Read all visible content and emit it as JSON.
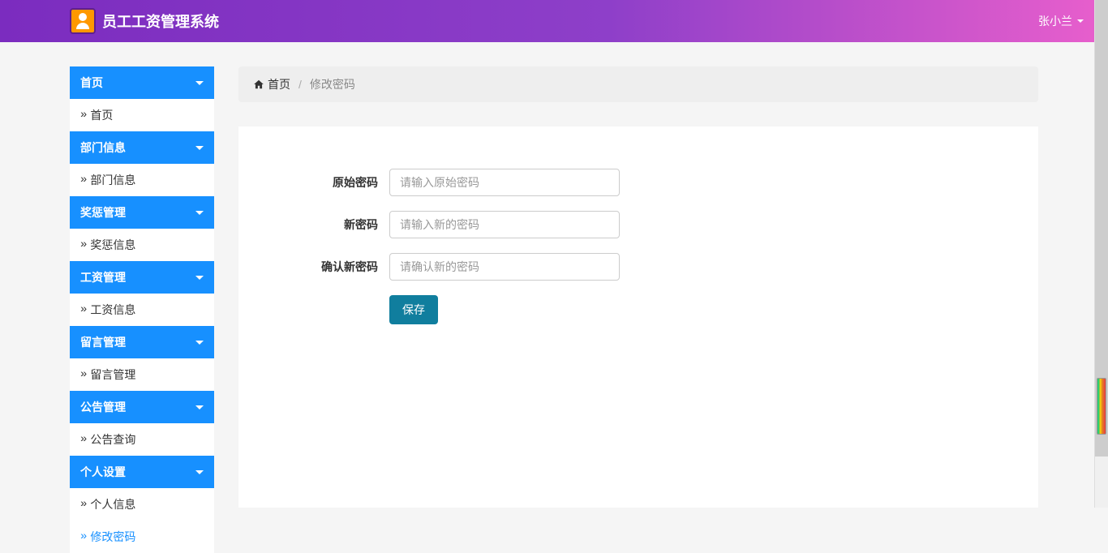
{
  "header": {
    "title": "员工工资管理系统",
    "user_name": "张小兰"
  },
  "sidebar": [
    {
      "label": "首页",
      "items": [
        {
          "label": "首页",
          "active": false
        }
      ]
    },
    {
      "label": "部门信息",
      "items": [
        {
          "label": "部门信息",
          "active": false
        }
      ]
    },
    {
      "label": "奖惩管理",
      "items": [
        {
          "label": "奖惩信息",
          "active": false
        }
      ]
    },
    {
      "label": "工资管理",
      "items": [
        {
          "label": "工资信息",
          "active": false
        }
      ]
    },
    {
      "label": "留言管理",
      "items": [
        {
          "label": "留言管理",
          "active": false
        }
      ]
    },
    {
      "label": "公告管理",
      "items": [
        {
          "label": "公告查询",
          "active": false
        }
      ]
    },
    {
      "label": "个人设置",
      "items": [
        {
          "label": "个人信息",
          "active": false
        },
        {
          "label": "修改密码",
          "active": true
        }
      ]
    }
  ],
  "breadcrumb": {
    "home": "首页",
    "current": "修改密码"
  },
  "form": {
    "original_pwd": {
      "label": "原始密码",
      "placeholder": "请输入原始密码",
      "value": ""
    },
    "new_pwd": {
      "label": "新密码",
      "placeholder": "请输入新的密码",
      "value": ""
    },
    "confirm_pwd": {
      "label": "确认新密码",
      "placeholder": "请确认新的密码",
      "value": ""
    },
    "save_btn": "保存"
  }
}
